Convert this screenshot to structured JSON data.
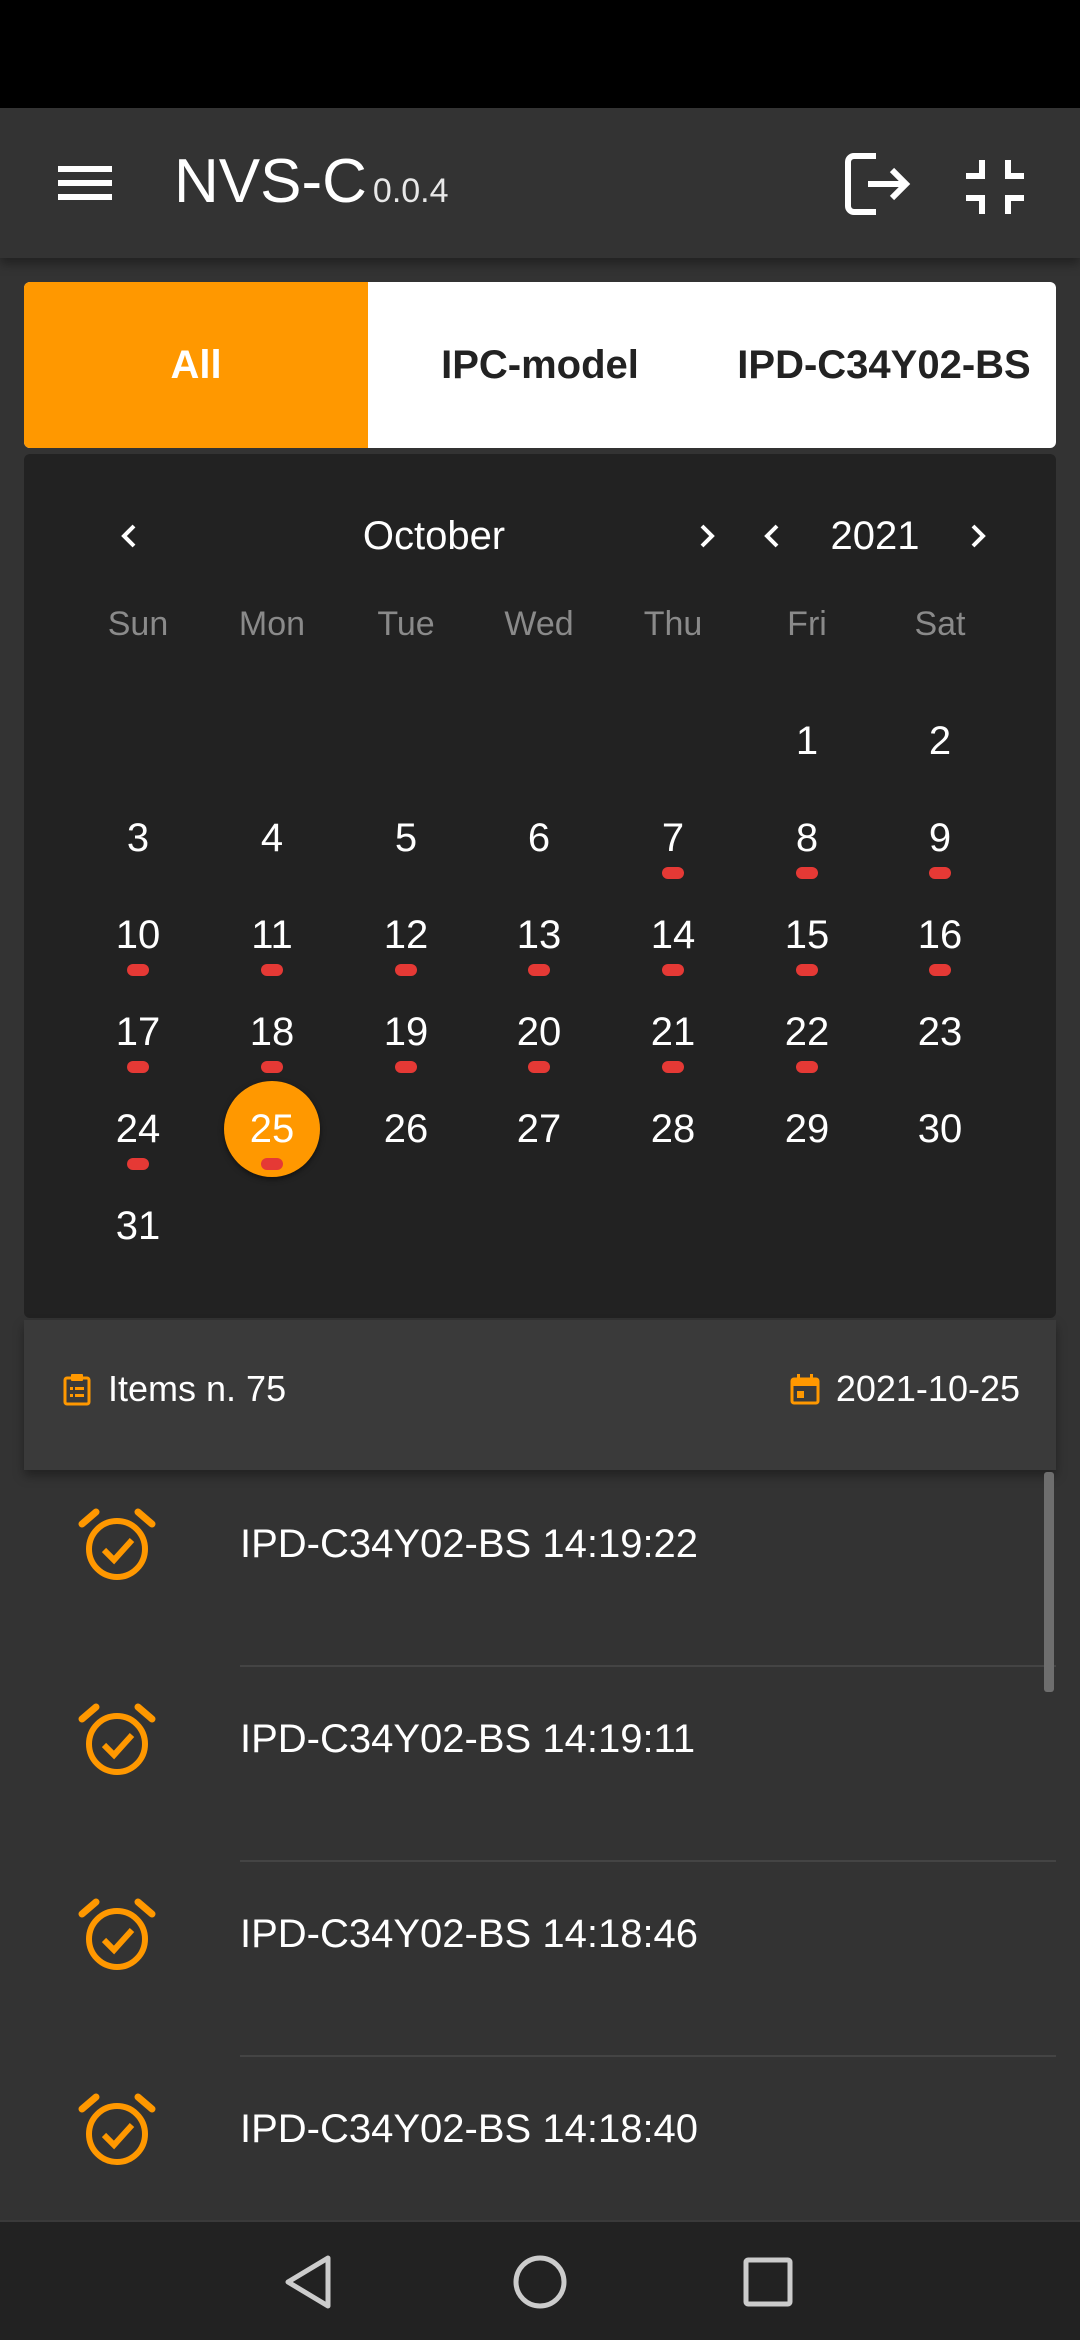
{
  "app_bar": {
    "title": "NVS-C",
    "version": "0.0.4",
    "icons": {
      "menu": "hamburger-menu-icon",
      "logout": "logout-icon",
      "collapse": "fullscreen-exit-icon"
    }
  },
  "tabs": [
    {
      "label": "All",
      "active": true
    },
    {
      "label": "IPC-model",
      "active": false
    },
    {
      "label": "IPD-C34Y02-BS",
      "active": false
    }
  ],
  "calendar": {
    "month": "October",
    "year": "2021",
    "weekdays": [
      "Sun",
      "Mon",
      "Tue",
      "Wed",
      "Thu",
      "Fri",
      "Sat"
    ],
    "first_weekday_index": 5,
    "days_in_month": 31,
    "selected_day": 25,
    "days_with_events": [
      7,
      8,
      9,
      10,
      11,
      12,
      13,
      14,
      15,
      16,
      17,
      18,
      19,
      20,
      21,
      22,
      24,
      25
    ]
  },
  "summary": {
    "items_label": "Items n. 75",
    "date_label": "2021-10-25"
  },
  "list": {
    "items": [
      {
        "text": "IPD-C34Y02-BS 14:19:22"
      },
      {
        "text": "IPD-C34Y02-BS 14:19:11"
      },
      {
        "text": "IPD-C34Y02-BS 14:18:46"
      },
      {
        "text": "IPD-C34Y02-BS 14:18:40"
      }
    ]
  },
  "colors": {
    "accent": "#ff9800",
    "event_dot": "#e53935",
    "background": "#333333",
    "calendar_bg": "#222222"
  }
}
